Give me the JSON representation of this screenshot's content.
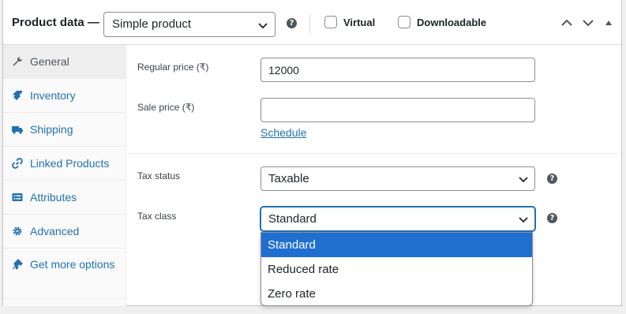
{
  "header": {
    "title": "Product data —",
    "product_type": "Simple product",
    "virtual_label": "Virtual",
    "downloadable_label": "Downloadable"
  },
  "sidebar": {
    "items": [
      {
        "label": "General",
        "icon": "wrench-icon",
        "active": true
      },
      {
        "label": "Inventory",
        "icon": "tag-icon"
      },
      {
        "label": "Shipping",
        "icon": "truck-icon"
      },
      {
        "label": "Linked Products",
        "icon": "link-icon"
      },
      {
        "label": "Attributes",
        "icon": "list-icon"
      },
      {
        "label": "Advanced",
        "icon": "gear-icon"
      },
      {
        "label": "Get more options",
        "icon": "plugin-icon"
      }
    ]
  },
  "general": {
    "regular_price_label": "Regular price (₹)",
    "regular_price_value": "12000",
    "sale_price_label": "Sale price (₹)",
    "sale_price_value": "",
    "schedule_link": "Schedule",
    "tax_status_label": "Tax status",
    "tax_status_value": "Taxable",
    "tax_class_label": "Tax class",
    "tax_class_value": "Standard"
  },
  "tax_class_dropdown": {
    "options": [
      "Standard",
      "Reduced rate",
      "Zero rate"
    ],
    "selected": "Standard"
  },
  "colors": {
    "accent": "#2271b1",
    "selected_option": "#1f6fd1",
    "border": "#8c8f94"
  }
}
